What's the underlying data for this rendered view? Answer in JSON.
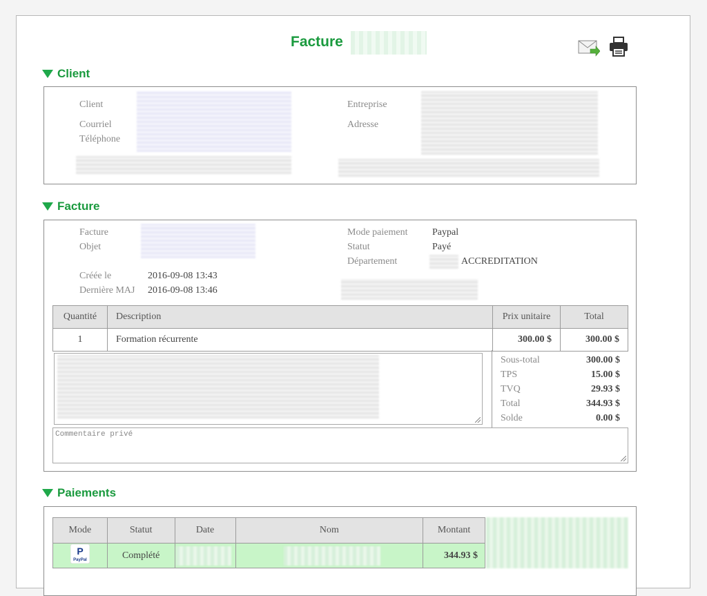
{
  "header": {
    "title": "Facture",
    "mail_icon": "mail-send-icon",
    "print_icon": "printer-icon"
  },
  "sections": {
    "client": "Client",
    "facture": "Facture",
    "paiements": "Paiements"
  },
  "client": {
    "client_label": "Client",
    "courriel_label": "Courriel",
    "telephone_label": "Téléphone",
    "entreprise_label": "Entreprise",
    "adresse_label": "Adresse"
  },
  "facture": {
    "facture_label": "Facture",
    "objet_label": "Objet",
    "creee_label": "Créée le",
    "creee_value": "2016-09-08 13:43",
    "maj_label": "Dernière MAJ",
    "maj_value": "2016-09-08 13:46",
    "mode_label": "Mode paiement",
    "mode_value": "Paypal",
    "statut_label": "Statut",
    "statut_value": "Payé",
    "departement_label": "Département",
    "departement_value": "ACCREDITATION"
  },
  "items": {
    "headers": [
      "Quantité",
      "Description",
      "Prix unitaire",
      "Total"
    ],
    "rows": [
      {
        "qty": "1",
        "description": "Formation récurrente",
        "unit": "300.00 $",
        "total": "300.00 $"
      }
    ]
  },
  "totals": {
    "sous_total_label": "Sous-total",
    "sous_total": "300.00 $",
    "tps_label": "TPS",
    "tps": "15.00 $",
    "tvq_label": "TVQ",
    "tvq": "29.93 $",
    "total_label": "Total",
    "total": "344.93 $",
    "solde_label": "Solde",
    "solde": "0.00 $"
  },
  "comment": {
    "placeholder": "Commentaire privé"
  },
  "payments": {
    "headers": [
      "Mode",
      "Statut",
      "Date",
      "Nom",
      "Montant"
    ],
    "rows": [
      {
        "mode_icon": "paypal-icon",
        "statut": "Complété",
        "montant": "344.93 $"
      }
    ]
  },
  "colors": {
    "accent": "#1a9a3e",
    "paid_row": "#c8f5c8"
  }
}
